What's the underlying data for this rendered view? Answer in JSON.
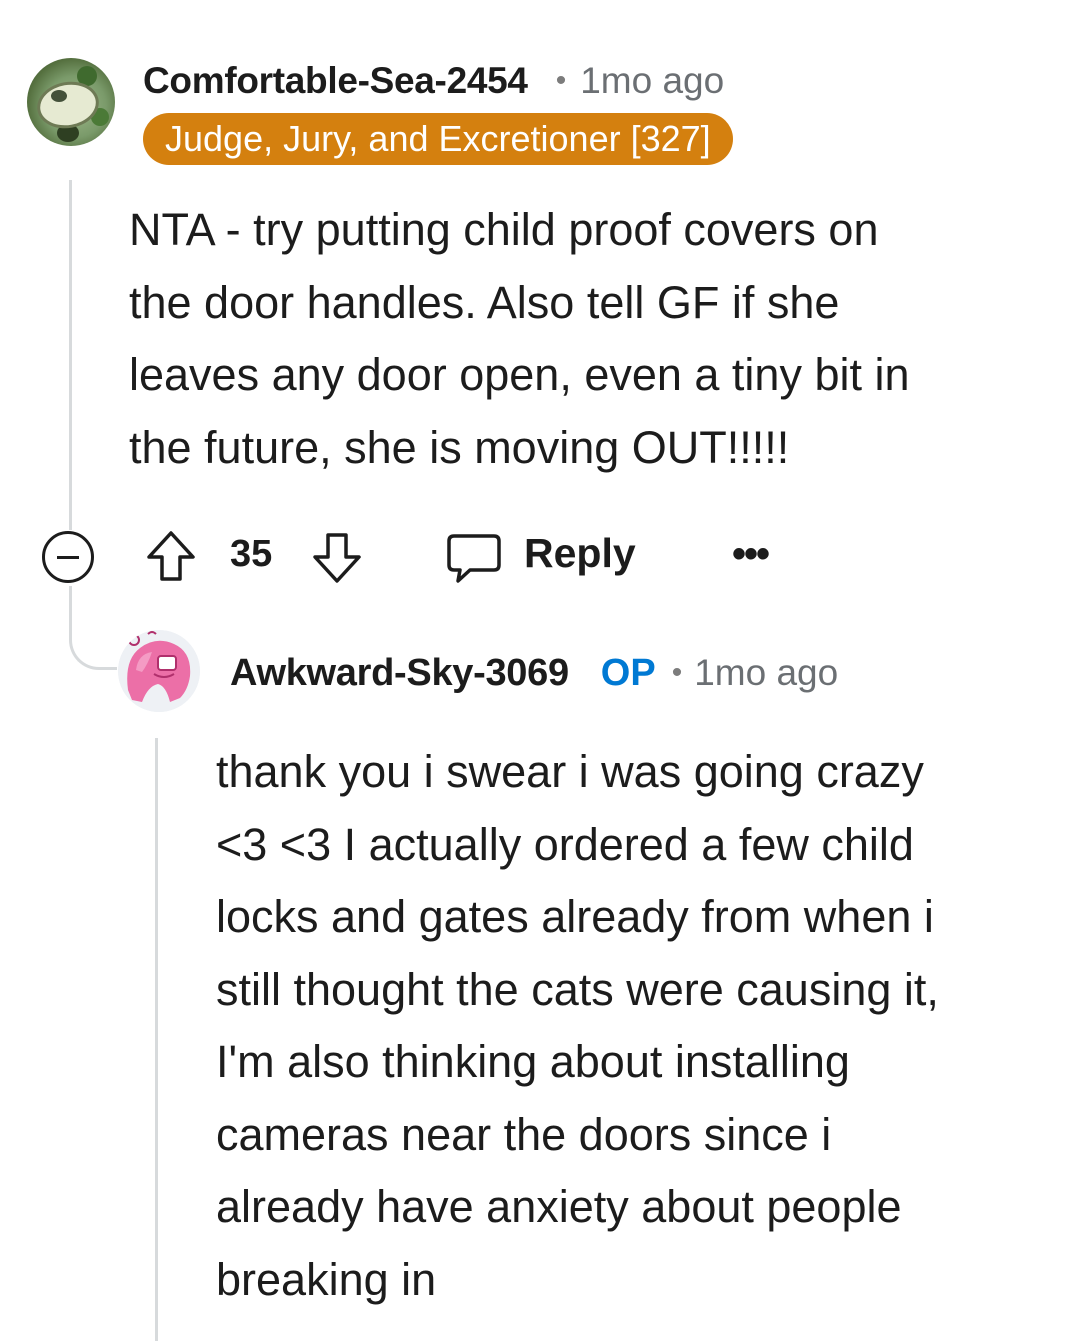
{
  "comment": {
    "username": "Comfortable-Sea-2454",
    "separator": "•",
    "time": "1mo ago",
    "flair": "Judge, Jury, and Excretioner [327]",
    "body_lines": [
      "NTA - try putting child proof covers on",
      "the door handles. Also tell GF if she",
      "leaves any door open, even a tiny bit in",
      "the future, she is moving OUT!!!!!"
    ],
    "votes": "35",
    "reply_label": "Reply",
    "more_label": "•••",
    "avatar_icon": "user-avatar-green",
    "icons": {
      "collapse": "collapse-minus-icon",
      "upvote": "upvote-arrow-icon",
      "downvote": "downvote-arrow-icon",
      "reply": "comment-bubble-icon",
      "more": "more-options-icon"
    }
  },
  "reply": {
    "username": "Awkward-Sky-3069",
    "op_tag": "OP",
    "separator": "•",
    "time": "1mo ago",
    "avatar_icon": "user-avatar-pink",
    "body_lines": [
      "thank you i swear i was going crazy",
      "<3 <3 I actually ordered a few child",
      "locks and gates already from when i",
      "still thought the cats were causing it,",
      "I'm also thinking about installing",
      "cameras near the doors since i",
      "already have anxiety about people",
      "breaking in"
    ]
  },
  "colors": {
    "flair_bg": "#d4800f",
    "op_tag": "#0079d3",
    "thread_line": "#d7dadc",
    "text": "#1c1c1c",
    "meta_text": "#6b6f73"
  }
}
